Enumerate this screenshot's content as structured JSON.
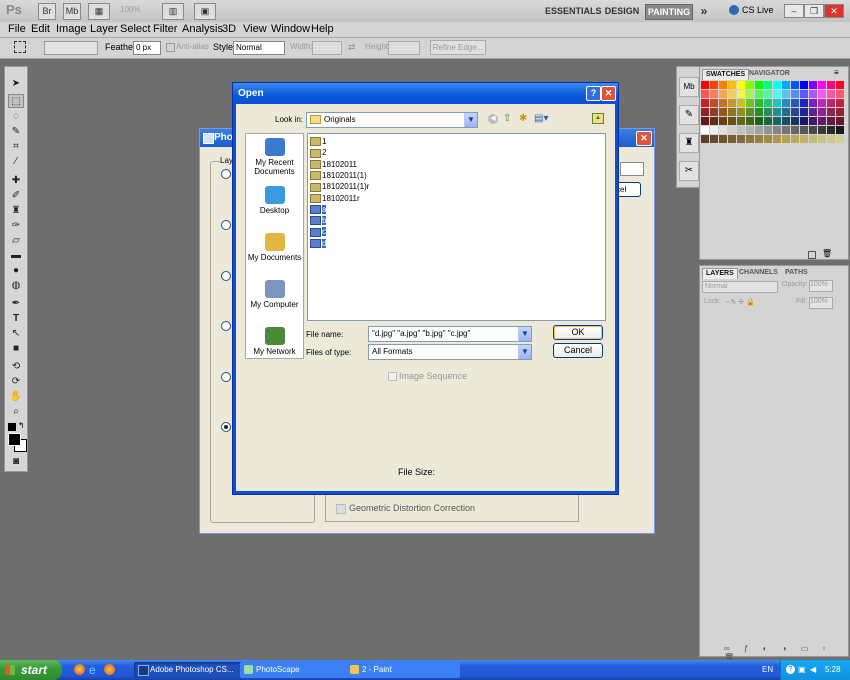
{
  "app_bar": {
    "logo": "Ps",
    "zoom": "100%",
    "workspaces": [
      "ESSENTIALS",
      "DESIGN",
      "PAINTING"
    ],
    "active_workspace": "PAINTING",
    "more": "»",
    "cs_live": "CS Live"
  },
  "menu": [
    "File",
    "Edit",
    "Image",
    "Layer",
    "Select",
    "Filter",
    "Analysis",
    "3D",
    "View",
    "Window",
    "Help"
  ],
  "options_bar": {
    "feather_label": "Feather:",
    "feather_value": "0 px",
    "antialias_label": "Anti-alias",
    "style_label": "Style:",
    "style_value": "Normal",
    "width_label": "Width:",
    "height_label": "Height:",
    "refine_edge": "Refine Edge..."
  },
  "panels": {
    "swatches_tab": "SWATCHES",
    "navigator_tab": "NAVIGATOR",
    "layers_tab": "LAYERS",
    "channels_tab": "CHANNELS",
    "paths_tab": "PATHS",
    "blend_mode": "Normal",
    "opacity_label": "Opacity:",
    "opacity_value": "100%",
    "lock_label": "Lock:",
    "fill_label": "Fill:",
    "fill_value": "100%"
  },
  "background_dialog": {
    "title": "Phot",
    "group_label": "Lay",
    "button_label": "cel",
    "checkbox_label": "Geometric Distortion Correction"
  },
  "open_dialog": {
    "title": "Open",
    "look_in_label": "Look in:",
    "look_in_value": "Originals",
    "places": [
      {
        "label": "My Recent Documents",
        "icon": "recent-documents-icon"
      },
      {
        "label": "Desktop",
        "icon": "desktop-icon"
      },
      {
        "label": "My Documents",
        "icon": "my-documents-icon"
      },
      {
        "label": "My Computer",
        "icon": "my-computer-icon"
      },
      {
        "label": "My Network",
        "icon": "my-network-icon"
      }
    ],
    "files": [
      {
        "name": "1",
        "selected": false
      },
      {
        "name": "2",
        "selected": false
      },
      {
        "name": "18102011",
        "selected": false
      },
      {
        "name": "18102011(1)",
        "selected": false
      },
      {
        "name": "18102011(1)r",
        "selected": false
      },
      {
        "name": "18102011r",
        "selected": false
      },
      {
        "name": "a",
        "selected": true
      },
      {
        "name": "b",
        "selected": true
      },
      {
        "name": "c",
        "selected": true
      },
      {
        "name": "d",
        "selected": true
      }
    ],
    "file_name_label": "File name:",
    "file_name_value": "\"d.jpg\" \"a.jpg\" \"b.jpg\" \"c.jpg\"",
    "file_type_label": "Files of type:",
    "file_type_value": "All Formats",
    "ok_label": "OK",
    "cancel_label": "Cancel",
    "image_sequence_label": "Image Sequence",
    "file_size_label": "File Size:"
  },
  "taskbar": {
    "start_label": "start",
    "tasks": [
      "Adobe Photoshop CS...",
      "PhotoScape",
      "2 - Paint"
    ],
    "language": "EN",
    "clock": "5:28"
  },
  "colors": {
    "xp_blue": "#0a4fd4",
    "taskbar_blue": "#245edb",
    "selection": "#316ac5",
    "start_green": "#3a9a3a",
    "canvas_gray": "#6e6e6e"
  }
}
